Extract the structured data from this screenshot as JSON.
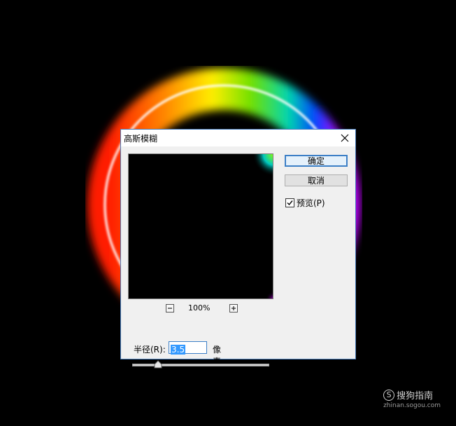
{
  "dialog": {
    "title": "高斯模糊",
    "ok_label": "确定",
    "cancel_label": "取消",
    "preview_checkbox_label": "预览(P)",
    "preview_checked": true,
    "zoom_level": "100%",
    "radius_label": "半径(R):",
    "radius_value": "3.5",
    "radius_unit": "像素",
    "radius_slider_fraction": 0.19
  },
  "watermark": {
    "logo_glyph": "S",
    "text": "搜狗指南",
    "url": "zhinan.sogou.com"
  },
  "colors": {
    "accent": "#3c7fc6",
    "dialog_bg": "#f0f0f0",
    "canvas_bg": "#000000",
    "selection": "#3399ff"
  },
  "icons": [
    "close-icon",
    "zoom-out-icon",
    "zoom-in-icon",
    "checkmark-icon",
    "slider-thumb-icon",
    "sogou-logo-icon"
  ]
}
